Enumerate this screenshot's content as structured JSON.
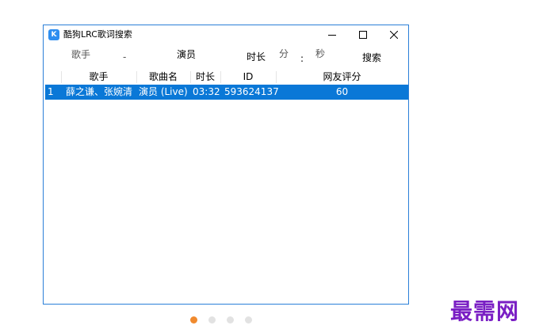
{
  "window": {
    "app_icon_glyph": "K",
    "title": "酷狗LRC歌词搜索",
    "controls": {
      "minimize": "minimize-icon",
      "maximize": "maximize-icon",
      "close": "close-icon"
    }
  },
  "search": {
    "singer_label": "歌手",
    "singer_value": "",
    "dash": "-",
    "song_value": "演员",
    "duration_label": "时长",
    "minutes_label": "分",
    "colon": ":",
    "seconds_label": "秒",
    "search_button": "搜索"
  },
  "table": {
    "columns": [
      "歌手",
      "歌曲名",
      "时长",
      "ID",
      "网友评分"
    ],
    "rows": [
      {
        "index": "1",
        "singer": "薛之谦、张婉清",
        "song": "演员 (Live)",
        "duration": "03:32",
        "id": "593624137",
        "rating": "60"
      }
    ],
    "selected_color": "#0a78d7"
  },
  "carousel": {
    "count": 4,
    "active_index": 0,
    "active_color": "#f08a2e"
  },
  "watermark": {
    "text": "最需网",
    "color": "#7a1fc4"
  },
  "colors": {
    "border": "#2b7fd8",
    "app_icon": "#2e8ef0"
  }
}
